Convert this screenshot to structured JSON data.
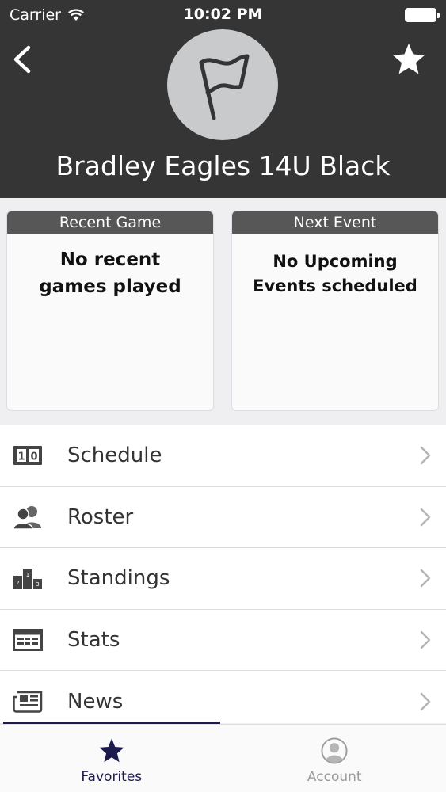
{
  "status_bar": {
    "carrier": "Carrier",
    "time": "10:02 PM"
  },
  "header": {
    "team_name": "Bradley Eagles 14U Black",
    "back_icon": "chevron-left-icon",
    "favorite_icon": "star-icon",
    "logo_icon": "flag-icon"
  },
  "cards": {
    "recent_game": {
      "title": "Recent Game",
      "line1": "No recent",
      "line2": "games played"
    },
    "next_event": {
      "title": "Next Event",
      "line1": "No Upcoming",
      "line2": "Events scheduled"
    }
  },
  "menu": {
    "items": [
      {
        "label": "Schedule",
        "icon": "scoreboard-icon"
      },
      {
        "label": "Roster",
        "icon": "people-icon"
      },
      {
        "label": "Standings",
        "icon": "podium-icon"
      },
      {
        "label": "Stats",
        "icon": "stats-table-icon"
      },
      {
        "label": "News",
        "icon": "newspaper-icon"
      }
    ]
  },
  "tabbar": {
    "favorites": "Favorites",
    "account": "Account"
  },
  "colors": {
    "header_bg": "#353535",
    "card_header_bg": "#575757",
    "accent": "#1c1a4e",
    "inactive": "#9b9b9b"
  }
}
